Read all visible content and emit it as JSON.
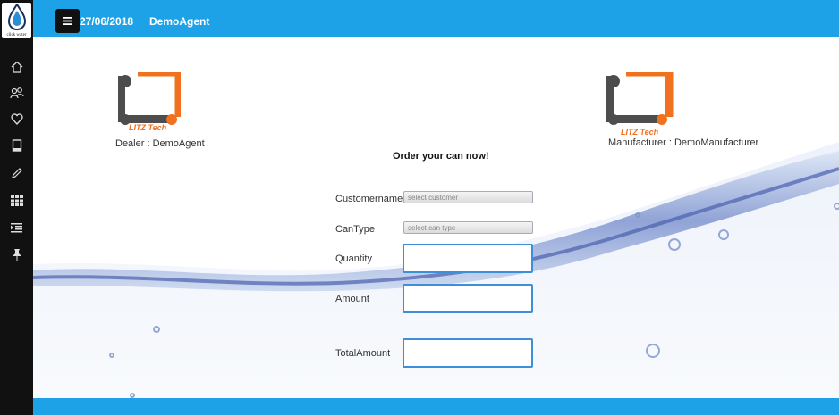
{
  "brand": {
    "name": "click water"
  },
  "header": {
    "date": "27/06/2018",
    "user": "DemoAgent"
  },
  "sidebar": {
    "items": [
      {
        "icon": "home-icon"
      },
      {
        "icon": "users-icon"
      },
      {
        "icon": "heart-icon"
      },
      {
        "icon": "book-icon"
      },
      {
        "icon": "pencil-icon"
      },
      {
        "icon": "grid-icon"
      },
      {
        "icon": "list-icon"
      },
      {
        "icon": "pin-icon"
      }
    ]
  },
  "logos": {
    "brand_text": "LITZ Tech",
    "dealer_caption": "Dealer : DemoAgent",
    "manufacturer_caption": "Manufacturer :  DemoManufacturer"
  },
  "form": {
    "title": "Order your can now!",
    "customer_label": "Customername",
    "customer_placeholder": "select customer",
    "cantype_label": "CanType",
    "cantype_placeholder": "select can type",
    "quantity_label": "Quantity",
    "amount_label": "Amount",
    "total_label": "TotalAmount"
  },
  "colors": {
    "topbar": "#1ea2e7",
    "sidebar": "#111111",
    "logo_orange": "#f2711e",
    "logo_gray": "#4d4d4d"
  }
}
